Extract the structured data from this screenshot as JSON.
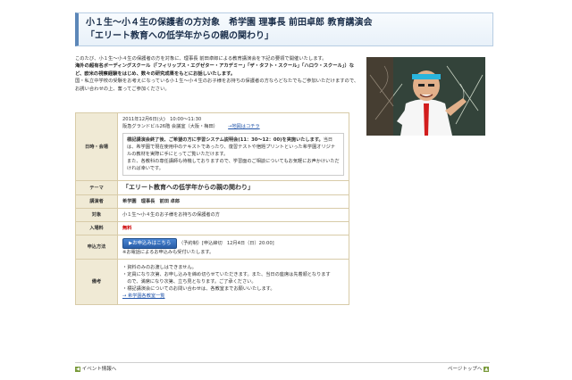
{
  "title": {
    "line1": "小１生〜小４生の保護者の方対象　希学園 理事長 前田卓郎 教育講演会",
    "line2": "「エリート教育への低学年からの親の関わり」"
  },
  "intro": {
    "p1": "このたび、小１生〜小４生の保護者の方を対象に、理事長 前田卓郎による教育講演会を下記の要領で開催いたします。",
    "p2": "海外の超有名ボーディングスクール（「フィリップス・エグゼター・アカデミー」「ザ・タフト・スクール」「ハロウ・スクール」）など、欧米の視察経験をはじめ、数々の研究成果をもとにお話しいたします。",
    "p3": "国・私立中学校の受験をお考えになっている小１生〜小４生のお子様をお持ちの保護者の方ならどなたでもご参加いただけますので、お誘い合わせの上、奮ってご参加ください。"
  },
  "rows": {
    "datetime": {
      "label": "日時・会場",
      "date": "2011年12月6日(火)　10:00〜11:30",
      "venue": "阪急グランドビル26階 会議室（大阪・梅田）",
      "map_link": "→地図はコチラ",
      "notice_bold": "標記講演会終了後、ご希望の方に学習システム説明会(11：30〜12：00)を実施いたします。",
      "notice_text": "当日は、希学園で現在使用中のテキストであったり、復習テストや宿題プリントといった希学園オリジナルの教材を実際に手にとってご覧いただけます。",
      "notice_text2": "また、各教科の専任講師も待機しておりますので、学習面のご相談についてもお気軽にお声かけいただければ幸いです。"
    },
    "theme": {
      "label": "テーマ",
      "value": "「エリート教育への低学年からの親の関わり」"
    },
    "lecturer": {
      "label": "講演者",
      "value": "希学園　理事長　前田 卓郎"
    },
    "target": {
      "label": "対象",
      "value": "小１生〜小４生のお子様をお持ちの保護者の方"
    },
    "fee": {
      "label": "入場料",
      "value": "無料"
    },
    "apply": {
      "label": "申込方法",
      "button": "▶お申込みはこちら",
      "after_button": "（予約制）[申込締切　12月4日（日）20:00]",
      "note": "※お電話によるお申込みも受付いたします。"
    },
    "remarks": {
      "label": "備考",
      "l1": "・資料のみのお渡しはできません。",
      "l2": "・定員になり次第、お申し込みを締め切らせていただきます。また、当日の座席は先着順となります",
      "l3": "　ので、満席になり次第、立ち見となります。ご了承ください。",
      "l4": "・標記講演会についてのお問い合わせは、各教室までお願いいたします。",
      "link": "→ 希学園各教室一覧"
    }
  },
  "nav": {
    "back": "イベント情報へ",
    "top": "ページトップへ"
  },
  "colors": {
    "accent": "#5c87b8",
    "label_bg": "#f0ead5",
    "border": "#d8cba8",
    "link": "#2255aa",
    "red": "#cc0000",
    "button": "#2a5ea8"
  }
}
